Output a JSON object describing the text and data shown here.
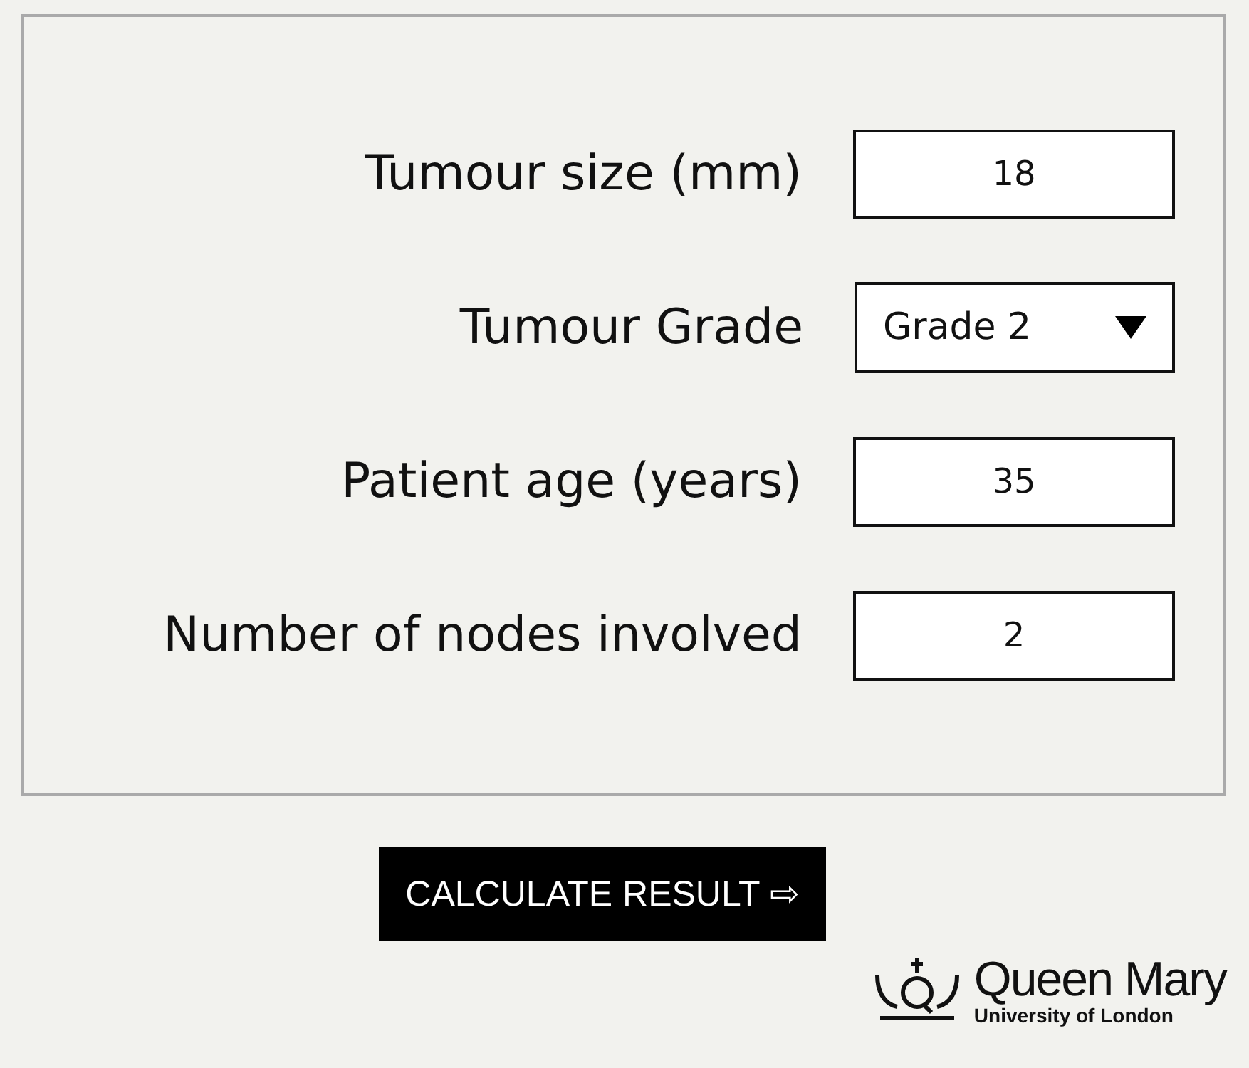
{
  "fields": [
    {
      "kind": "input",
      "label": "Tumour size (mm)",
      "value": "18"
    },
    {
      "kind": "select",
      "label": "Tumour Grade",
      "value": "Grade 2"
    },
    {
      "kind": "input",
      "label": "Patient age (years)",
      "value": "35"
    },
    {
      "kind": "input",
      "label": "Number of nodes involved",
      "value": "2"
    }
  ],
  "button": {
    "label": "CALCULATE RESULT ⇨"
  },
  "logo": {
    "name": "Queen Mary",
    "subtitle": "University of London"
  }
}
